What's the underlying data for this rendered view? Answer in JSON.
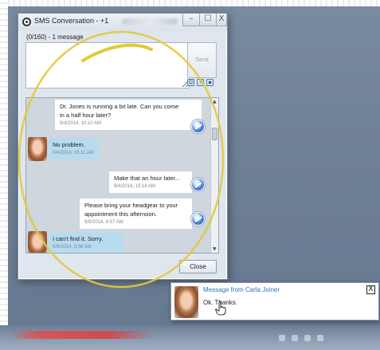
{
  "window": {
    "title": "SMS Conversation - +1",
    "controls": {
      "minimize": "–",
      "maximize": "☐",
      "close": "X"
    }
  },
  "compose": {
    "counter": "(0/160) - 1 message",
    "send_label": "Send",
    "tools": [
      "emoticon-icon",
      "help-icon",
      "save-icon"
    ]
  },
  "conversation": {
    "messages": [
      {
        "direction": "out",
        "text_lines": [
          "Dr. Jones is running a bit late. Can you come",
          "in a half hour later?"
        ],
        "time": "9/4/2014, 10:10 AM"
      },
      {
        "direction": "in",
        "text_lines": [
          "No problem."
        ],
        "time": "9/4/2014, 10:11 AM"
      },
      {
        "direction": "out",
        "text_lines": [
          "Make that an hour later..."
        ],
        "time": "9/4/2014, 10:16 AM"
      },
      {
        "direction": "out",
        "text_lines": [
          "Please bring your headgear to your",
          "appointment this afternoon."
        ],
        "time": "9/9/2014, 8:57 AM"
      },
      {
        "direction": "in",
        "text_lines": [
          "I can't find it. Sorry."
        ],
        "time": "9/9/2014, 8:58 AM"
      }
    ]
  },
  "footer": {
    "close_label": "Close"
  },
  "notification": {
    "title": "Message from Carla Joiner",
    "text": "Ok. Thanks.",
    "close_label": "X"
  },
  "colors": {
    "outgoing_bubble": "#ffffff",
    "incoming_bubble": "#b7dcef",
    "notification_title": "#2e6fbd",
    "annotation_ellipse": "#e2c83a"
  }
}
